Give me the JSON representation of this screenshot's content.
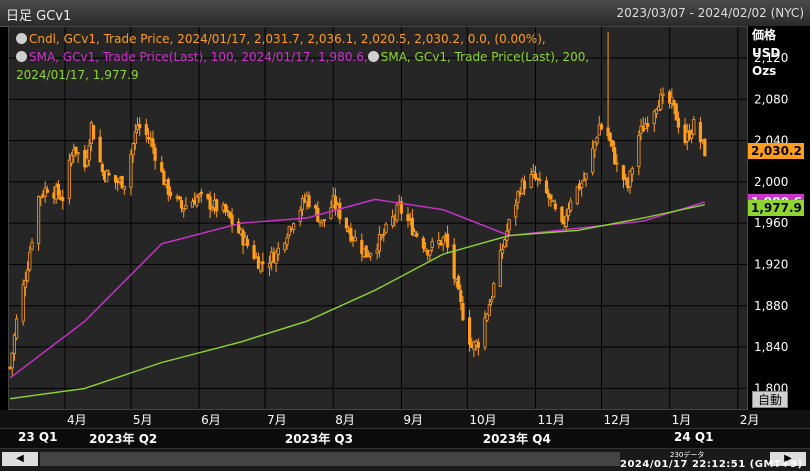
{
  "header": {
    "title": "日足 GCv1",
    "range": "2023/03/07 - 2024/02/02 (NYC)"
  },
  "legend": {
    "candle": "Cndl, GCv1, Trade Price, 2024/01/17, 2,031.7, 2,036.1, 2,020.5, 2,030.2, 0.0, (0.00%),",
    "sma100": "SMA, GCv1, Trade Price(Last),  100, 2024/01/17, 1,980.6,",
    "sma200": "SMA, GCv1, Trade Price(Last),  200,",
    "sma200_cont": "2024/01/17, 1,977.9"
  },
  "units": [
    "価格",
    "USD",
    "Ozs"
  ],
  "tags": {
    "last": "2,030.2",
    "sma100": "1,980.6",
    "sma200": "1,977.9"
  },
  "buttons": {
    "auto": "自動"
  },
  "footer": {
    "note": "230データ",
    "timestamp": "2024/01/17 22:12:51 (GMT+9)"
  },
  "colors": {
    "candle": "#ff9d1c",
    "sma100": "#cc33cc",
    "sma200": "#8ed62f",
    "background": "#262626"
  },
  "chart_data": {
    "type": "candlestick",
    "instrument": "GCv1",
    "ylim": [
      1780,
      2150
    ],
    "yticks": [
      1800,
      1840,
      1880,
      1920,
      1960,
      2000,
      2040,
      2080,
      2120
    ],
    "ytick_labels": [
      "1,800",
      "1,840",
      "1,880",
      "1,920",
      "1,960",
      "2,000",
      "2,040",
      "2,080",
      "2,120"
    ],
    "x_month_labels": [
      "4月",
      "5月",
      "6月",
      "7月",
      "8月",
      "9月",
      "10月",
      "11月",
      "12月",
      "1月",
      "2月"
    ],
    "x_quarter_labels": [
      "23 Q1",
      "2023年 Q2",
      "2023年 Q3",
      "2023年 Q4",
      "24 Q1"
    ],
    "xlim": [
      "2023-03-07",
      "2024-02-02"
    ],
    "close_series": [
      [
        "2023-03-07",
        1820
      ],
      [
        "2023-03-10",
        1865
      ],
      [
        "2023-03-15",
        1920
      ],
      [
        "2023-03-20",
        1985
      ],
      [
        "2023-03-24",
        1995
      ],
      [
        "2023-03-31",
        1985
      ],
      [
        "2023-04-05",
        2035
      ],
      [
        "2023-04-10",
        2015
      ],
      [
        "2023-04-13",
        2055
      ],
      [
        "2023-04-18",
        2010
      ],
      [
        "2023-04-24",
        2000
      ],
      [
        "2023-04-28",
        2000
      ],
      [
        "2023-05-04",
        2055
      ],
      [
        "2023-05-10",
        2040
      ],
      [
        "2023-05-17",
        1995
      ],
      [
        "2023-05-24",
        1975
      ],
      [
        "2023-05-31",
        1985
      ],
      [
        "2023-06-05",
        1980
      ],
      [
        "2023-06-13",
        1970
      ],
      [
        "2023-06-21",
        1945
      ],
      [
        "2023-06-29",
        1920
      ],
      [
        "2023-07-06",
        1930
      ],
      [
        "2023-07-14",
        1965
      ],
      [
        "2023-07-20",
        1985
      ],
      [
        "2023-07-27",
        1960
      ],
      [
        "2023-08-01",
        1980
      ],
      [
        "2023-08-09",
        1950
      ],
      [
        "2023-08-16",
        1930
      ],
      [
        "2023-08-23",
        1945
      ],
      [
        "2023-08-31",
        1975
      ],
      [
        "2023-09-06",
        1955
      ],
      [
        "2023-09-13",
        1935
      ],
      [
        "2023-09-21",
        1945
      ],
      [
        "2023-09-28",
        1880
      ],
      [
        "2023-10-03",
        1840
      ],
      [
        "2023-10-06",
        1845
      ],
      [
        "2023-10-12",
        1890
      ],
      [
        "2023-10-18",
        1945
      ],
      [
        "2023-10-25",
        1995
      ],
      [
        "2023-10-31",
        2005
      ],
      [
        "2023-11-07",
        1985
      ],
      [
        "2023-11-13",
        1955
      ],
      [
        "2023-11-17",
        1985
      ],
      [
        "2023-11-24",
        2005
      ],
      [
        "2023-11-30",
        2055
      ],
      [
        "2023-12-04",
        2045
      ],
      [
        "2023-12-08",
        2015
      ],
      [
        "2023-12-13",
        1995
      ],
      [
        "2023-12-18",
        2045
      ],
      [
        "2023-12-27",
        2080
      ],
      [
        "2024-01-02",
        2075
      ],
      [
        "2024-01-08",
        2040
      ],
      [
        "2024-01-12",
        2055
      ],
      [
        "2024-01-17",
        2030
      ]
    ],
    "series": [
      {
        "name": "SMA 100",
        "values": [
          [
            "2023-03-07",
            1810
          ],
          [
            "2023-04-10",
            1865
          ],
          [
            "2023-05-15",
            1940
          ],
          [
            "2023-06-20",
            1960
          ],
          [
            "2023-07-20",
            1965
          ],
          [
            "2023-08-20",
            1983
          ],
          [
            "2023-09-20",
            1973
          ],
          [
            "2023-10-20",
            1948
          ],
          [
            "2023-11-20",
            1955
          ],
          [
            "2023-12-20",
            1962
          ],
          [
            "2024-01-17",
            1980.6
          ]
        ]
      },
      {
        "name": "SMA 200",
        "values": [
          [
            "2023-03-07",
            1790
          ],
          [
            "2023-04-10",
            1800
          ],
          [
            "2023-05-15",
            1825
          ],
          [
            "2023-06-20",
            1845
          ],
          [
            "2023-07-20",
            1865
          ],
          [
            "2023-08-20",
            1895
          ],
          [
            "2023-09-20",
            1930
          ],
          [
            "2023-10-20",
            1948
          ],
          [
            "2023-11-20",
            1953
          ],
          [
            "2023-12-20",
            1965
          ],
          [
            "2024-01-17",
            1977.9
          ]
        ]
      }
    ],
    "last": {
      "date": "2024-01-17",
      "open": 2031.7,
      "high": 2036.1,
      "low": 2020.5,
      "close": 2030.2
    }
  }
}
